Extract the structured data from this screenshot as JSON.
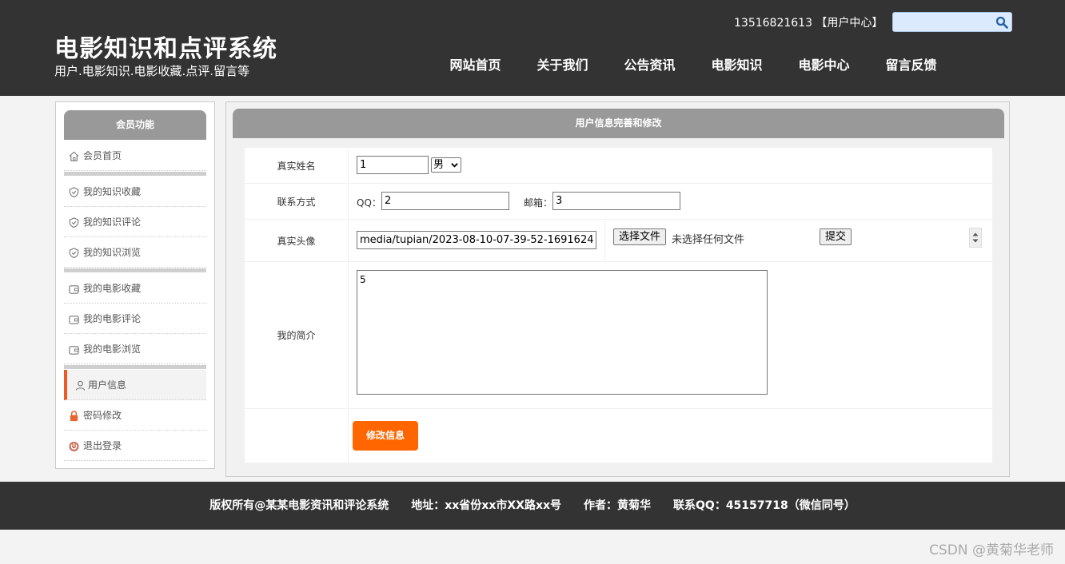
{
  "header": {
    "title": "电影知识和点评系统",
    "subtitle": "用户.电影知识.电影收藏.点评.留言等",
    "user_link": "13516821613 【用户中心】",
    "search": {
      "value": "",
      "placeholder": ""
    },
    "nav": [
      "网站首页",
      "关于我们",
      "公告资讯",
      "电影知识",
      "电影中心",
      "留言反馈"
    ]
  },
  "sidebar": {
    "title": "会员功能",
    "items": [
      {
        "label": "会员首页",
        "icon": "home-icon"
      },
      {
        "label": "我的知识收藏",
        "icon": "shield-icon"
      },
      {
        "label": "我的知识评论",
        "icon": "shield-icon"
      },
      {
        "label": "我的知识浏览",
        "icon": "shield-icon"
      },
      {
        "label": "我的电影收藏",
        "icon": "wallet-icon"
      },
      {
        "label": "我的电影评论",
        "icon": "wallet-icon"
      },
      {
        "label": "我的电影浏览",
        "icon": "wallet-icon"
      },
      {
        "label": "用户信息",
        "icon": "user-icon",
        "active": true
      },
      {
        "label": "密码修改",
        "icon": "lock-icon"
      },
      {
        "label": "退出登录",
        "icon": "power-icon"
      }
    ]
  },
  "form": {
    "title": "用户信息完善和修改",
    "name_label": "真实姓名",
    "name_value": "1",
    "gender_value": "男",
    "contact_label": "联系方式",
    "qq_label": "QQ：",
    "qq_value": "2",
    "email_label": "邮箱：",
    "email_value": "3",
    "avatar_label": "真实头像",
    "avatar_path": "media/tupian/2023-08-10-07-39-52-1691624...",
    "choose_file_label": "选择文件",
    "no_file_text": "未选择任何文件",
    "upload_label": "提交",
    "bio_label": "我的简介",
    "bio_value": "5",
    "submit_label": "修改信息"
  },
  "footer": {
    "text": "版权所有@某某电影资讯和评论系统　　地址：xx省份xx市XX路xx号　　作者：黄菊华　　联系QQ：45157718（微信同号）"
  },
  "watermark": "CSDN @黄菊华老师",
  "colors": {
    "header_bg": "#333333",
    "accent": "#ff6600",
    "active_marker": "#f05a22",
    "panel_head": "#999999"
  }
}
